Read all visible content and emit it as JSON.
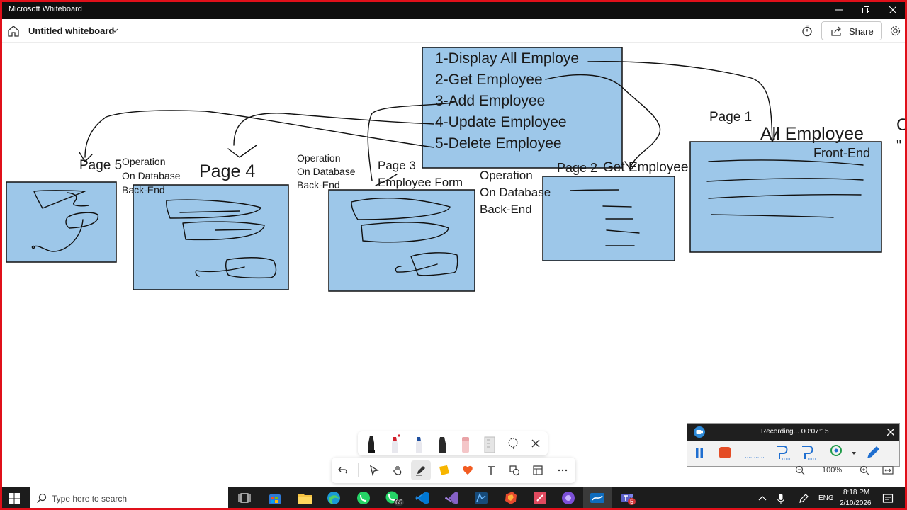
{
  "window": {
    "title": "Microsoft Whiteboard"
  },
  "header": {
    "doc_title": "Untitled whiteboard",
    "share_label": "Share"
  },
  "canvas": {
    "menu_items": [
      "1-Display All Employe",
      "2-Get Employee",
      "3-Add Employee",
      "4-Update Employee",
      "5-Delete Employee"
    ],
    "labels": {
      "page1": "Page 1",
      "all_employee": "All Employee",
      "front_end": "Front-End",
      "page2": "Page 2",
      "get_employee": "Get Employee",
      "op_line1": "Operation",
      "op_line2": "On Database",
      "op_line3": "Back-End",
      "page3": "Page 3",
      "employee_form": "Employee Form",
      "page4": "Page 4",
      "page5": "Page 5",
      "cut_char_1": "C",
      "cut_char_2": "\""
    }
  },
  "recording": {
    "status": "Recording... 00:07:15",
    "zoom": "100%"
  },
  "taskbar": {
    "search_placeholder": "Type here to search",
    "whatsapp_badge": "65",
    "teams_badge": "5",
    "lang": "ENG",
    "time": "8:18 PM",
    "date": "2/10/2026"
  },
  "colors": {
    "box_fill": "#9dc7e9",
    "title_bar": "#0f0f0f",
    "record_border": "#e0101a"
  }
}
